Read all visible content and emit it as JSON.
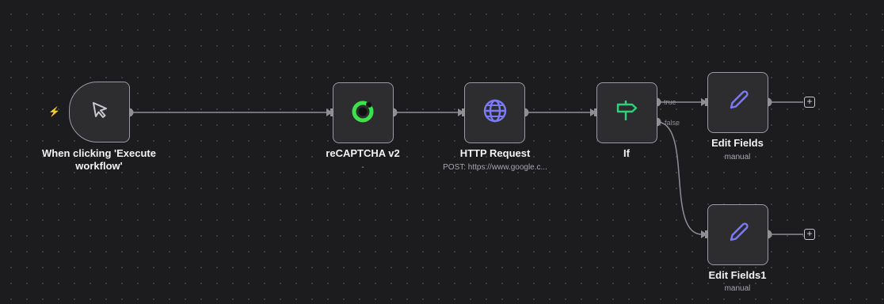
{
  "nodes": {
    "trigger": {
      "label": "When clicking 'Execute workflow'",
      "icon": "cursor-icon"
    },
    "recaptcha": {
      "label": "reCAPTCHA v2",
      "subtitle": "-",
      "icon": "recaptcha-icon"
    },
    "http": {
      "label": "HTTP Request",
      "subtitle": "POST: https://www.google.c...",
      "icon": "globe-icon"
    },
    "if": {
      "label": "If",
      "icon": "signpost-icon"
    },
    "edit1": {
      "label": "Edit Fields",
      "subtitle": "manual",
      "icon": "pencil-icon"
    },
    "edit2": {
      "label": "Edit Fields1",
      "subtitle": "manual",
      "icon": "pencil-icon"
    }
  },
  "edges": {
    "true_label": "true",
    "false_label": "false"
  },
  "add_button": "+",
  "trigger_badge": "⚡",
  "colors": {
    "accent_trigger": "#ff6d5a",
    "recaptcha_green": "#3ee04b",
    "globe_purple": "#7b7bfa",
    "signpost_green": "#2bd47b",
    "pencil_purple": "#7b7bfa"
  }
}
